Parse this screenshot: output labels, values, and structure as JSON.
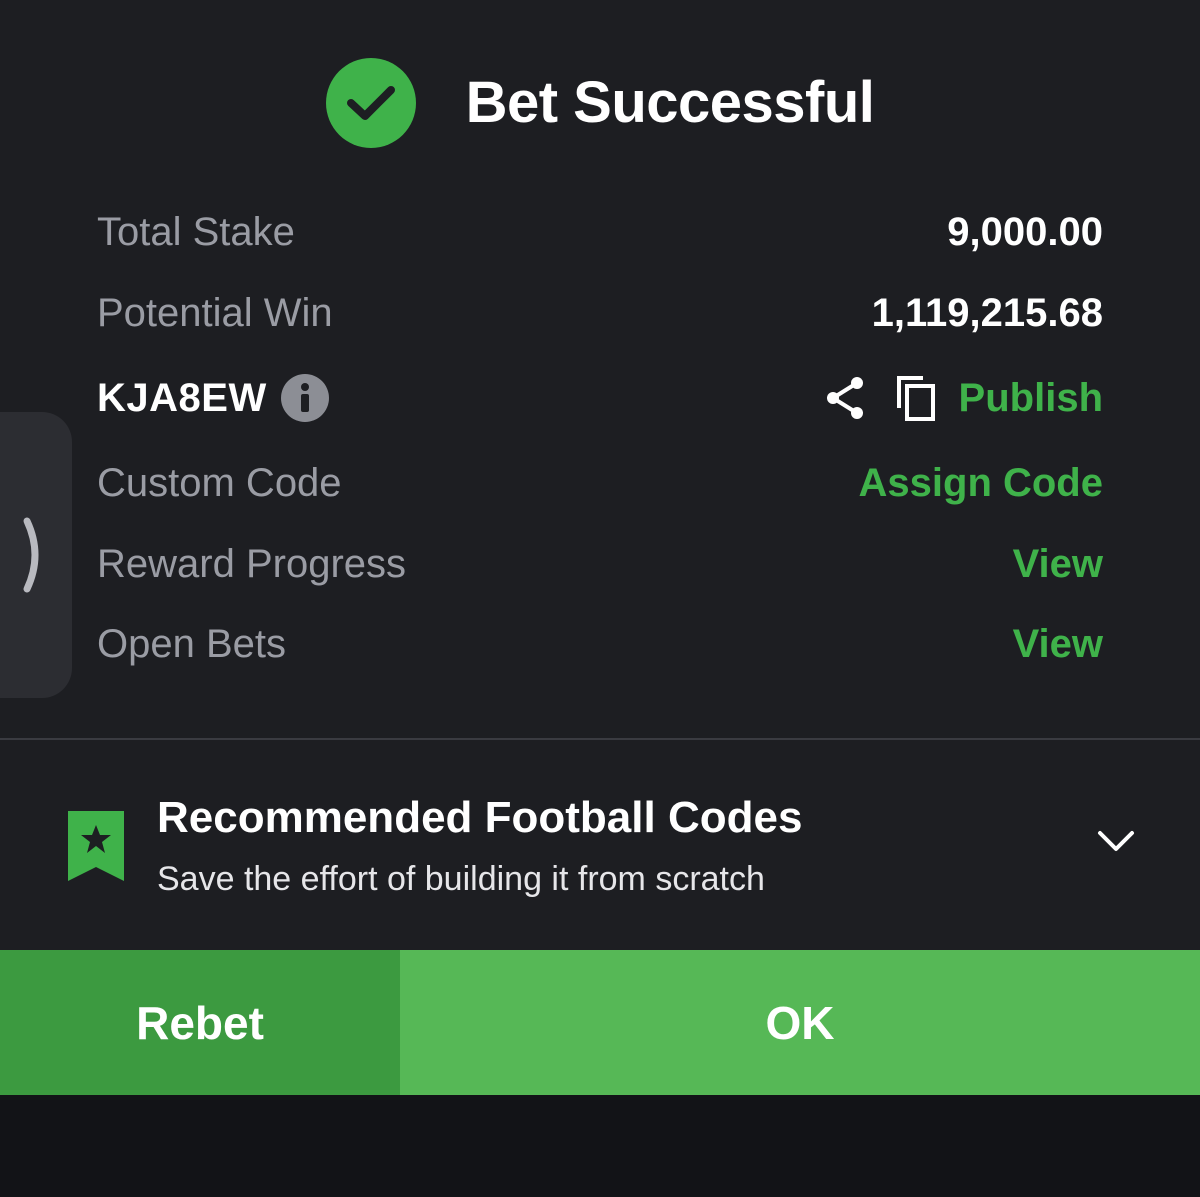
{
  "header": {
    "title": "Bet Successful",
    "icon": "check-circle-icon"
  },
  "details": {
    "total_stake_label": "Total Stake",
    "total_stake_value": "9,000.00",
    "potential_win_label": "Potential Win",
    "potential_win_value": "1,119,215.68",
    "booking_code": "KJA8EW",
    "publish_label": "Publish",
    "custom_code_label": "Custom Code",
    "assign_code_label": "Assign Code",
    "reward_progress_label": "Reward Progress",
    "reward_progress_link": "View",
    "open_bets_label": "Open Bets",
    "open_bets_link": "View"
  },
  "recommended": {
    "title": "Recommended Football Codes",
    "subtitle": "Save the effort of building it from scratch"
  },
  "buttons": {
    "rebet": "Rebet",
    "ok": "OK"
  },
  "colors": {
    "accent_green": "#3fb24a",
    "ok_button": "#56b856",
    "rebet_button": "#3c9a40",
    "background": "#1d1e22"
  }
}
